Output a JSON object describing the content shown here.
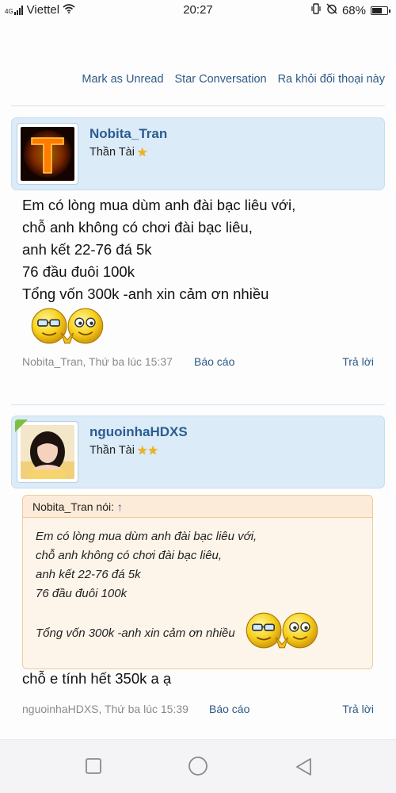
{
  "status_bar": {
    "network_tag": "4G",
    "carrier": "Viettel",
    "time": "20:27",
    "battery_percent": "68%",
    "battery_level": 0.68
  },
  "conversation_actions": {
    "mark_unread": "Mark as Unread",
    "star": "Star Conversation",
    "leave": "Ra khỏi đối thoại này"
  },
  "messages": [
    {
      "username": "Nobita_Tran",
      "user_title": "Thần Tài",
      "stars": 1,
      "lines": [
        "Em có lòng mua dùm anh đài bạc liêu với,",
        "chỗ anh không có chơi đài bạc liêu,",
        "anh kết 22-76 đá 5k",
        "76 đầu đuôi 100k",
        "Tổng vốn 300k -anh xin cảm ơn nhiều"
      ],
      "meta": "Nobita_Tran, Thứ ba lúc 15:37",
      "report": "Báo cáo",
      "reply": "Trả lời"
    },
    {
      "username": "nguoinhaHDXS",
      "user_title": "Thần Tài",
      "stars": 2,
      "quote": {
        "author_line": "Nobita_Tran nói:",
        "arrow": "↑",
        "lines": [
          "Em có lòng mua dùm anh đài bạc liêu với,",
          "chỗ anh không có chơi đài bạc liêu,",
          "anh kết 22-76 đá 5k",
          "76 đầu đuôi 100k"
        ],
        "last_line": "Tổng vốn 300k -anh xin cảm ơn nhiều"
      },
      "text": "chỗ e tính hết 350k a ạ",
      "meta": "nguoinhaHDXS, Thứ ba lúc 15:39",
      "report": "Báo cáo",
      "reply": "Trả lời"
    }
  ]
}
